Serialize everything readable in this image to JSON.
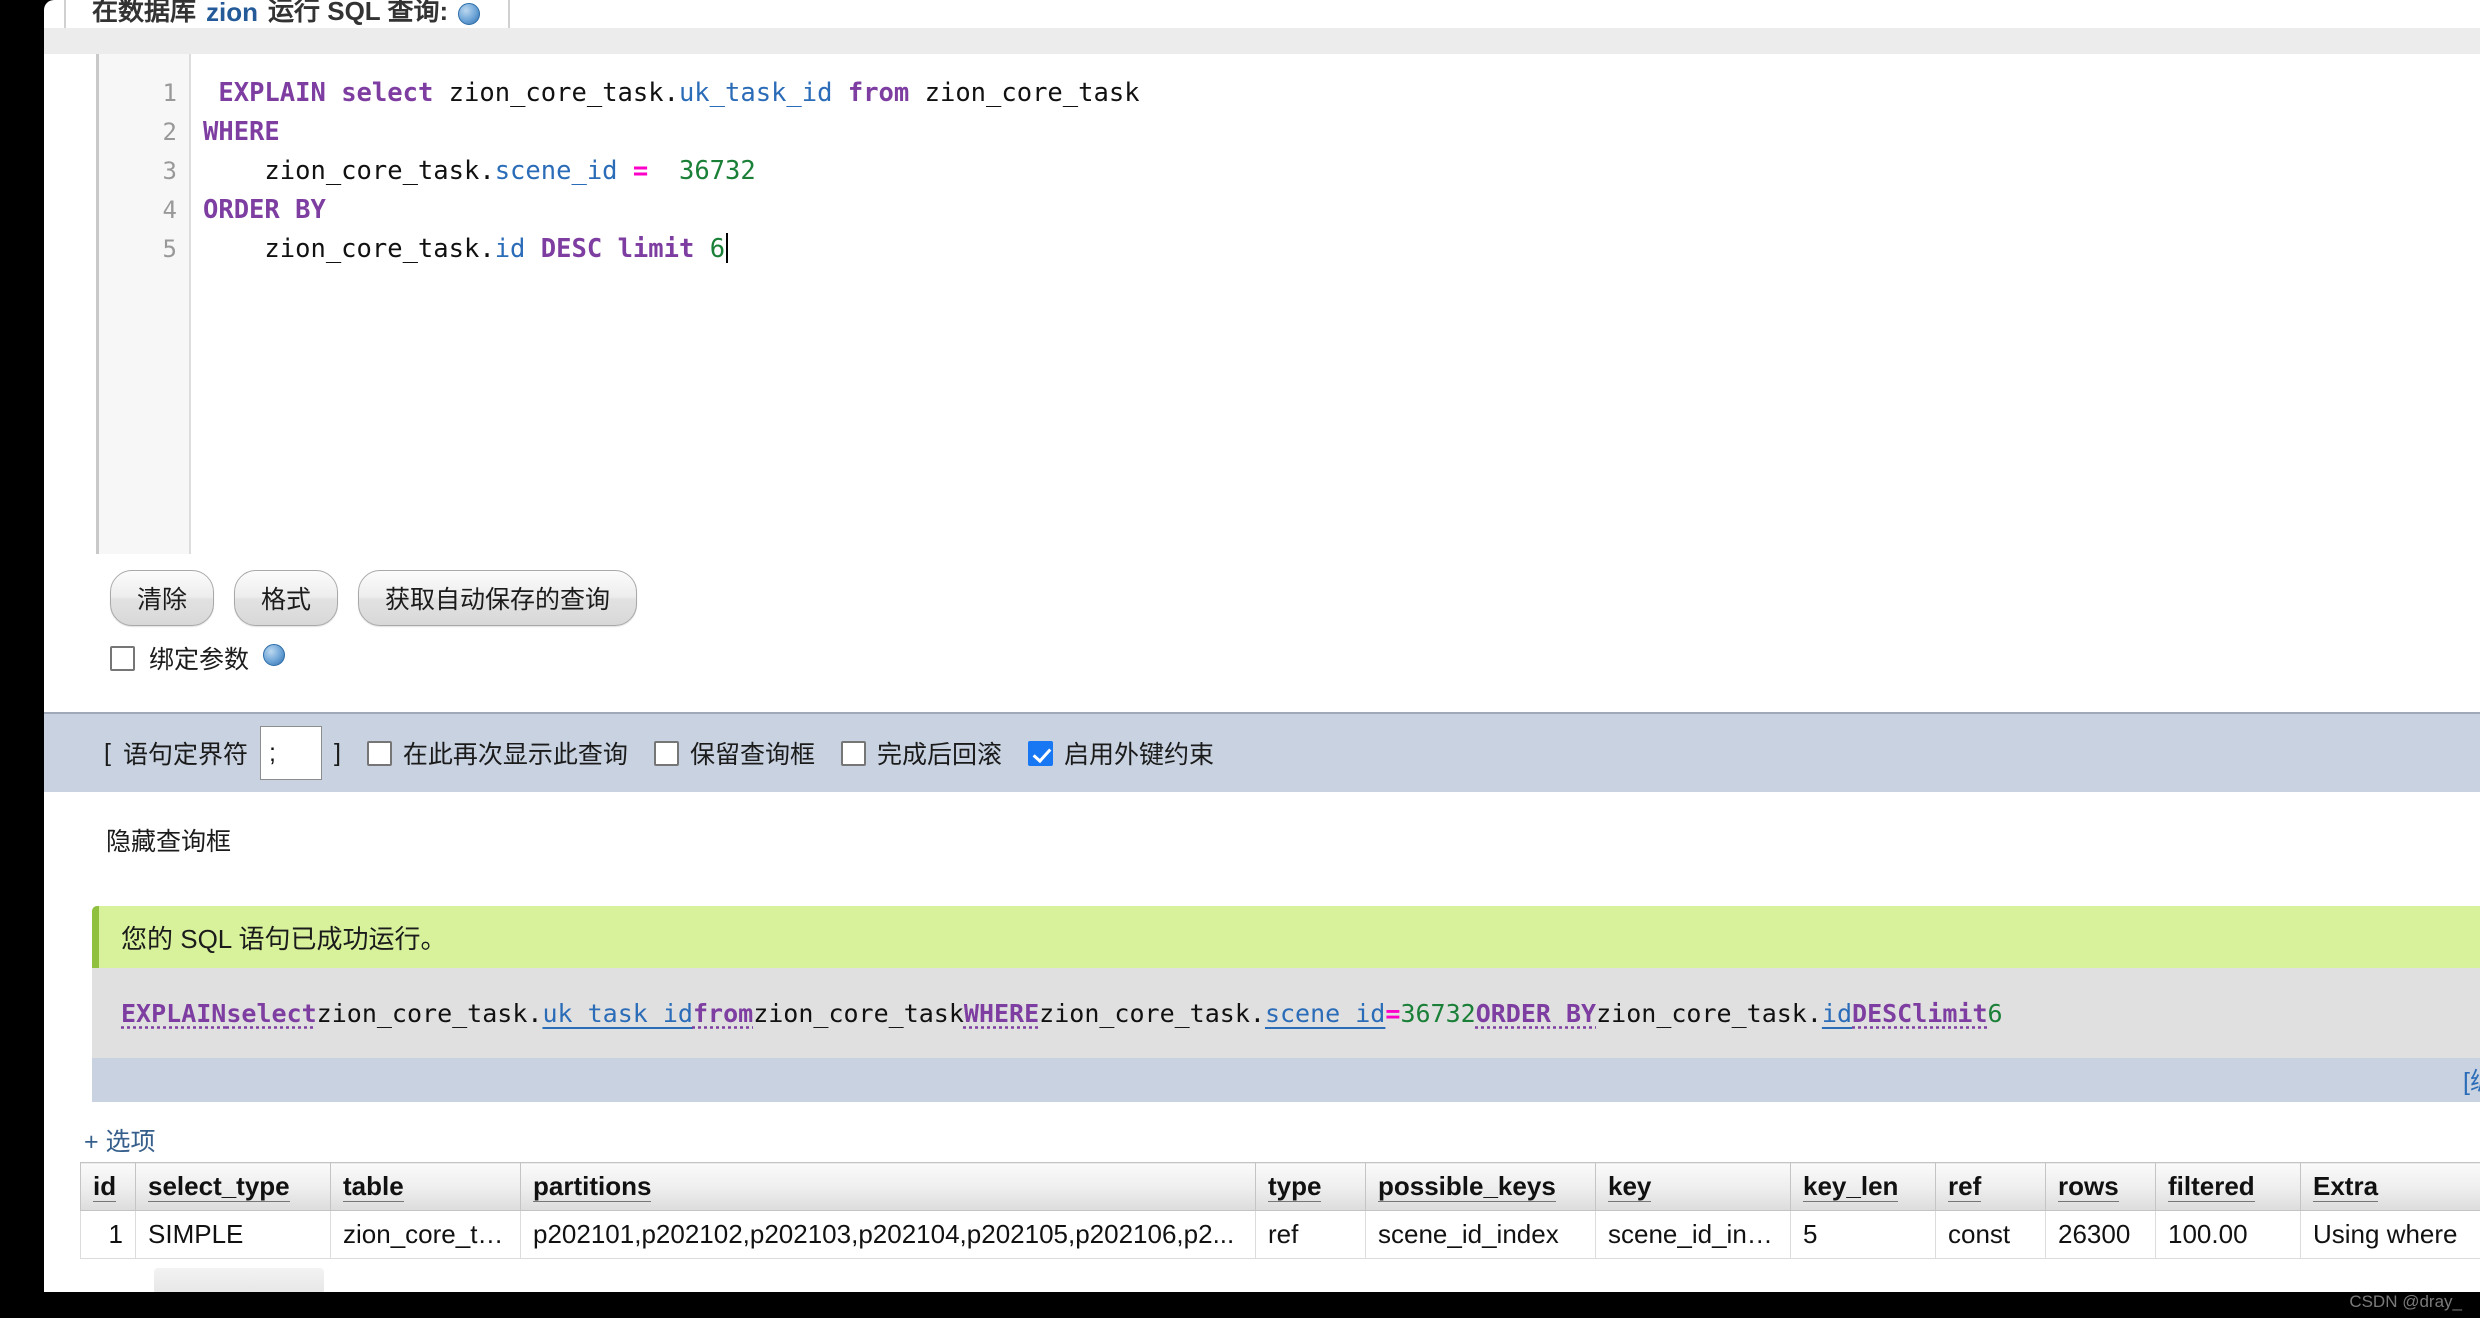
{
  "header": {
    "title_prefix": "在数据库",
    "db_name": "zion",
    "title_suffix": "运行 SQL 查询:",
    "help_icon": "help-icon"
  },
  "editor": {
    "lines": [
      {
        "num": "1",
        "tokens": [
          {
            "t": " ",
            "c": "pln"
          },
          {
            "t": "EXPLAIN",
            "c": "kw"
          },
          {
            "t": " ",
            "c": "pln"
          },
          {
            "t": "select",
            "c": "kw"
          },
          {
            "t": " zion_core_task.",
            "c": "pln"
          },
          {
            "t": "uk_task_id",
            "c": "idn"
          },
          {
            "t": " ",
            "c": "pln"
          },
          {
            "t": "from",
            "c": "kw"
          },
          {
            "t": " zion_core_task",
            "c": "pln"
          }
        ]
      },
      {
        "num": "2",
        "tokens": [
          {
            "t": "WHERE",
            "c": "kw"
          }
        ]
      },
      {
        "num": "3",
        "tokens": [
          {
            "t": "    zion_core_task.",
            "c": "pln"
          },
          {
            "t": "scene_id",
            "c": "idn"
          },
          {
            "t": " ",
            "c": "pln"
          },
          {
            "t": "=",
            "c": "op"
          },
          {
            "t": "  ",
            "c": "pln"
          },
          {
            "t": "36732",
            "c": "num"
          }
        ]
      },
      {
        "num": "4",
        "tokens": [
          {
            "t": "ORDER BY",
            "c": "kw"
          }
        ]
      },
      {
        "num": "5",
        "tokens": [
          {
            "t": "    zion_core_task.",
            "c": "pln"
          },
          {
            "t": "id",
            "c": "idn"
          },
          {
            "t": " ",
            "c": "pln"
          },
          {
            "t": "DESC",
            "c": "kw"
          },
          {
            "t": " ",
            "c": "pln"
          },
          {
            "t": "limit",
            "c": "kw"
          },
          {
            "t": " ",
            "c": "pln"
          },
          {
            "t": "6",
            "c": "num"
          }
        ],
        "caret": true
      }
    ]
  },
  "buttons": {
    "clear": "清除",
    "format": "格式",
    "get_autosaved": "获取自动保存的查询"
  },
  "bind_params": {
    "label": "绑定参数",
    "checked": false,
    "help_icon": "help-icon"
  },
  "delimiter": {
    "open_bracket": "[",
    "label": "语句定界符",
    "value": ";",
    "close_bracket": "]",
    "options": [
      {
        "label": "在此再次显示此查询",
        "checked": false
      },
      {
        "label": "保留查询框",
        "checked": false
      },
      {
        "label": "完成后回滚",
        "checked": false
      },
      {
        "label": "启用外键约束",
        "checked": true
      }
    ]
  },
  "hide_query": {
    "label": "隐藏查询框"
  },
  "success": {
    "message": "您的 SQL 语句已成功运行。"
  },
  "sql_echo": {
    "tokens": [
      {
        "t": "EXPLAIN",
        "c": "kw"
      },
      {
        "t": " ",
        "c": "pln"
      },
      {
        "t": "select",
        "c": "kw"
      },
      {
        "t": " zion_core_task.",
        "c": "pln"
      },
      {
        "t": "uk_task_id",
        "c": "idn"
      },
      {
        "t": " ",
        "c": "pln"
      },
      {
        "t": "from",
        "c": "kw"
      },
      {
        "t": " zion_core_task ",
        "c": "pln"
      },
      {
        "t": "WHERE",
        "c": "kw"
      },
      {
        "t": " zion_core_task.",
        "c": "pln"
      },
      {
        "t": "scene_id",
        "c": "idn"
      },
      {
        "t": " ",
        "c": "pln"
      },
      {
        "t": "=",
        "c": "op"
      },
      {
        "t": " ",
        "c": "pln"
      },
      {
        "t": "36732",
        "c": "num"
      },
      {
        "t": " ",
        "c": "pln"
      },
      {
        "t": "ORDER BY",
        "c": "kw"
      },
      {
        "t": " zion_core_task.",
        "c": "pln"
      },
      {
        "t": "id",
        "c": "idn"
      },
      {
        "t": " ",
        "c": "pln"
      },
      {
        "t": "DESC",
        "c": "kw"
      },
      {
        "t": " ",
        "c": "pln"
      },
      {
        "t": "limit",
        "c": "kw"
      },
      {
        "t": " ",
        "c": "pln"
      },
      {
        "t": "6",
        "c": "num"
      }
    ],
    "edit_link": "[编辑"
  },
  "options_link": {
    "label": "+ 选项"
  },
  "results_table": {
    "columns": [
      "id",
      "select_type",
      "table",
      "partitions",
      "type",
      "possible_keys",
      "key",
      "key_len",
      "ref",
      "rows",
      "filtered",
      "Extra"
    ],
    "rows": [
      {
        "id": "1",
        "select_type": "SIMPLE",
        "table": "zion_core_task",
        "partitions": "p202101,p202102,p202103,p202104,p202105,p202106,p2...",
        "type": "ref",
        "possible_keys": "scene_id_index",
        "key": "scene_id_index",
        "key_len": "5",
        "ref": "const",
        "rows": "26300",
        "filtered": "100.00",
        "Extra": "Using where"
      }
    ]
  },
  "watermark": {
    "text": "CSDN @dray_"
  }
}
